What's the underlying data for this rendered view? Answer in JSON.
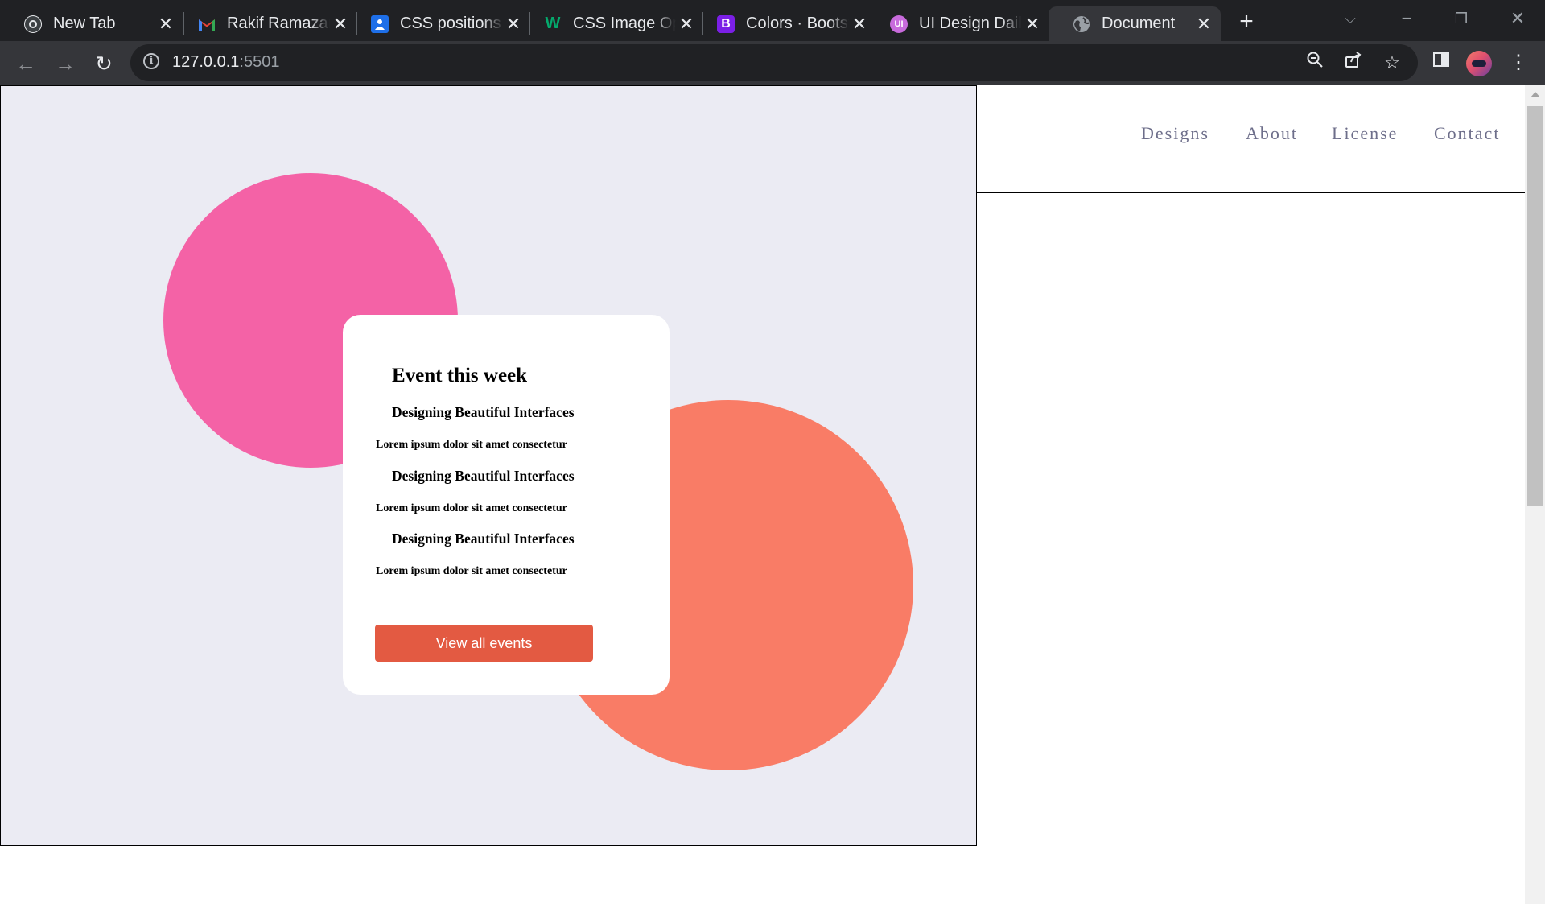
{
  "browser": {
    "tabs": [
      {
        "title": "New Tab",
        "icon": "chrome-icon"
      },
      {
        "title": "Rakif Ramazanov",
        "icon": "gmail-icon"
      },
      {
        "title": "CSS positions",
        "icon": "google-classroom-icon"
      },
      {
        "title": "CSS Image Opacity",
        "icon": "w3schools-icon"
      },
      {
        "title": "Colors · Bootstrap",
        "icon": "bootstrap-icon"
      },
      {
        "title": "UI Design Daily",
        "icon": "ui-design-daily-icon"
      },
      {
        "title": "Document",
        "icon": "globe-icon"
      }
    ],
    "active_tab_index": 6,
    "url_host": "127.0.0.1",
    "url_port": ":5501"
  },
  "page": {
    "nav": {
      "links": [
        "Designs",
        "About",
        "License",
        "Contact"
      ]
    },
    "card": {
      "title": "Event this week",
      "events": [
        {
          "name": "Designing Beautiful Interfaces",
          "desc": "Lorem ipsum dolor sit amet consectetur"
        },
        {
          "name": "Designing Beautiful Interfaces",
          "desc": "Lorem ipsum dolor sit amet consectetur"
        },
        {
          "name": "Designing Beautiful Interfaces",
          "desc": "Lorem ipsum dolor sit amet consectetur"
        }
      ],
      "button_label": "View all events"
    },
    "colors": {
      "hero_background": "#ebebf3",
      "pink_circle": "#f462a6",
      "coral_circle": "#f97c66",
      "button": "#e35a42",
      "nav_link": "#6d6e8a"
    }
  }
}
